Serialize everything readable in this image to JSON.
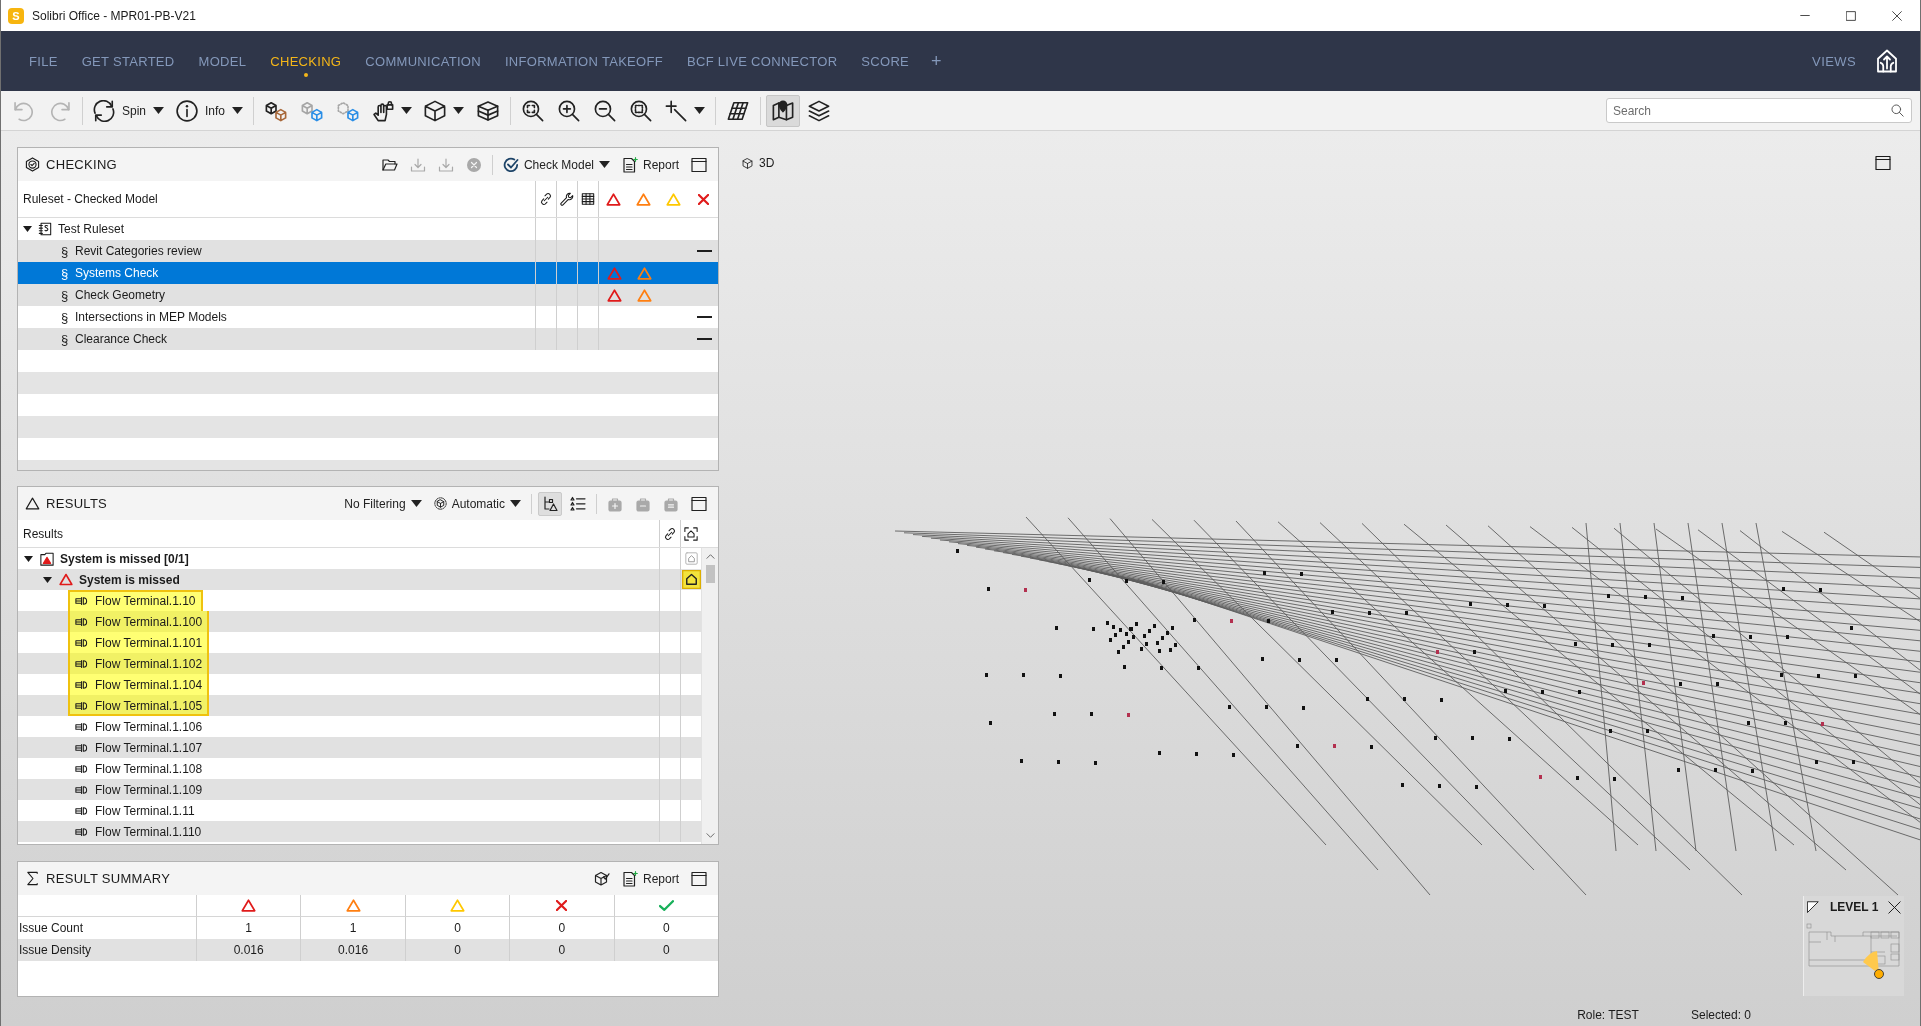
{
  "window": {
    "logo_letter": "S",
    "title": "Solibri Office - MPR01-PB-V21"
  },
  "menu": {
    "tabs": [
      {
        "label": "FILE",
        "selected": false
      },
      {
        "label": "GET STARTED",
        "selected": false
      },
      {
        "label": "MODEL",
        "selected": false
      },
      {
        "label": "CHECKING",
        "selected": true
      },
      {
        "label": "COMMUNICATION",
        "selected": false
      },
      {
        "label": "INFORMATION TAKEOFF",
        "selected": false
      },
      {
        "label": "BCF LIVE CONNECTOR",
        "selected": false
      },
      {
        "label": "SCORE",
        "selected": false
      }
    ],
    "add_tab": "+",
    "views_label": "VIEWS"
  },
  "toolbar": {
    "undo": {
      "disabled": true
    },
    "redo": {
      "disabled": true
    },
    "spin_label": "Spin",
    "info_label": "Info",
    "floor_plan": {
      "on": true
    },
    "search": {
      "placeholder": "Search"
    }
  },
  "checking_panel": {
    "title": "CHECKING",
    "tools": [
      {
        "kind": "open",
        "disabled": false
      },
      {
        "kind": "download",
        "disabled": true
      },
      {
        "kind": "download",
        "disabled": true
      },
      {
        "kind": "cancel",
        "disabled": true
      }
    ],
    "check_model_label": "Check Model",
    "report_label": "Report",
    "column_header": "Ruleset - Checked Model",
    "tree": [
      {
        "kind": "ruleset",
        "label": "Test Ruleset",
        "expanded": true,
        "selected": false,
        "children": [
          {
            "kind": "rule",
            "symbol": "§",
            "label": "Revit Categories review",
            "selected": false,
            "high": false,
            "medium": false,
            "dash": true
          },
          {
            "kind": "rule",
            "symbol": "§",
            "label": "Systems Check",
            "selected": true,
            "high": true,
            "medium": true,
            "dash": false
          },
          {
            "kind": "rule",
            "symbol": "§",
            "label": "Check Geometry",
            "selected": false,
            "high": true,
            "medium": true,
            "dash": false
          },
          {
            "kind": "rule",
            "symbol": "§",
            "label": "Intersections in MEP Models",
            "selected": false,
            "high": false,
            "medium": false,
            "dash": true
          },
          {
            "kind": "rule",
            "symbol": "§",
            "label": "Clearance Check",
            "selected": false,
            "high": false,
            "medium": false,
            "dash": true
          }
        ]
      }
    ]
  },
  "results_panel": {
    "title": "RESULTS",
    "filter_label": "No Filtering",
    "mode_label": "Automatic",
    "tree_view": {
      "on": true
    },
    "list_view": {
      "on": false
    },
    "tools": [
      {
        "kind": "add",
        "disabled": true
      },
      {
        "kind": "remove",
        "disabled": true
      },
      {
        "kind": "equal",
        "disabled": true
      }
    ],
    "column_header": "Results",
    "tree": [
      {
        "kind": "category",
        "label": "System is missed [0/1]",
        "expanded": true,
        "selected": false,
        "viewpoint_active": false,
        "children": [
          {
            "kind": "issue",
            "label": "System is missed",
            "expanded": true,
            "selected": false,
            "viewpoint_active": true,
            "children": [
              {
                "kind": "component",
                "label": "Flow Terminal.1.10",
                "selected": true
              },
              {
                "kind": "component",
                "label": "Flow Terminal.1.100",
                "selected": true
              },
              {
                "kind": "component",
                "label": "Flow Terminal.1.101",
                "selected": true
              },
              {
                "kind": "component",
                "label": "Flow Terminal.1.102",
                "selected": true
              },
              {
                "kind": "component",
                "label": "Flow Terminal.1.104",
                "selected": true
              },
              {
                "kind": "component",
                "label": "Flow Terminal.1.105",
                "selected": true
              },
              {
                "kind": "component",
                "label": "Flow Terminal.1.106",
                "selected": false
              },
              {
                "kind": "component",
                "label": "Flow Terminal.1.107",
                "selected": false
              },
              {
                "kind": "component",
                "label": "Flow Terminal.1.108",
                "selected": false
              },
              {
                "kind": "component",
                "label": "Flow Terminal.1.109",
                "selected": false
              },
              {
                "kind": "component",
                "label": "Flow Terminal.1.11",
                "selected": false
              },
              {
                "kind": "component",
                "label": "Flow Terminal.1.110",
                "selected": false
              }
            ]
          }
        ]
      }
    ]
  },
  "summary_panel": {
    "title": "RESULT SUMMARY",
    "report_label": "Report",
    "columns": [
      {
        "kind": "high"
      },
      {
        "kind": "medium"
      },
      {
        "kind": "low"
      },
      {
        "kind": "rejected"
      },
      {
        "kind": "accepted"
      }
    ],
    "rows": [
      {
        "label": "Issue Count",
        "values": [
          "1",
          "1",
          "0",
          "0",
          "0"
        ]
      },
      {
        "label": "Issue Density",
        "values": [
          "0.016",
          "0.016",
          "0",
          "0",
          "0"
        ]
      }
    ]
  },
  "view_3d": {
    "label": "3D",
    "minimap": {
      "label": "LEVEL 1"
    }
  },
  "status_bar": {
    "role": "Role: TEST",
    "selection_count": "Selected: 0"
  }
}
